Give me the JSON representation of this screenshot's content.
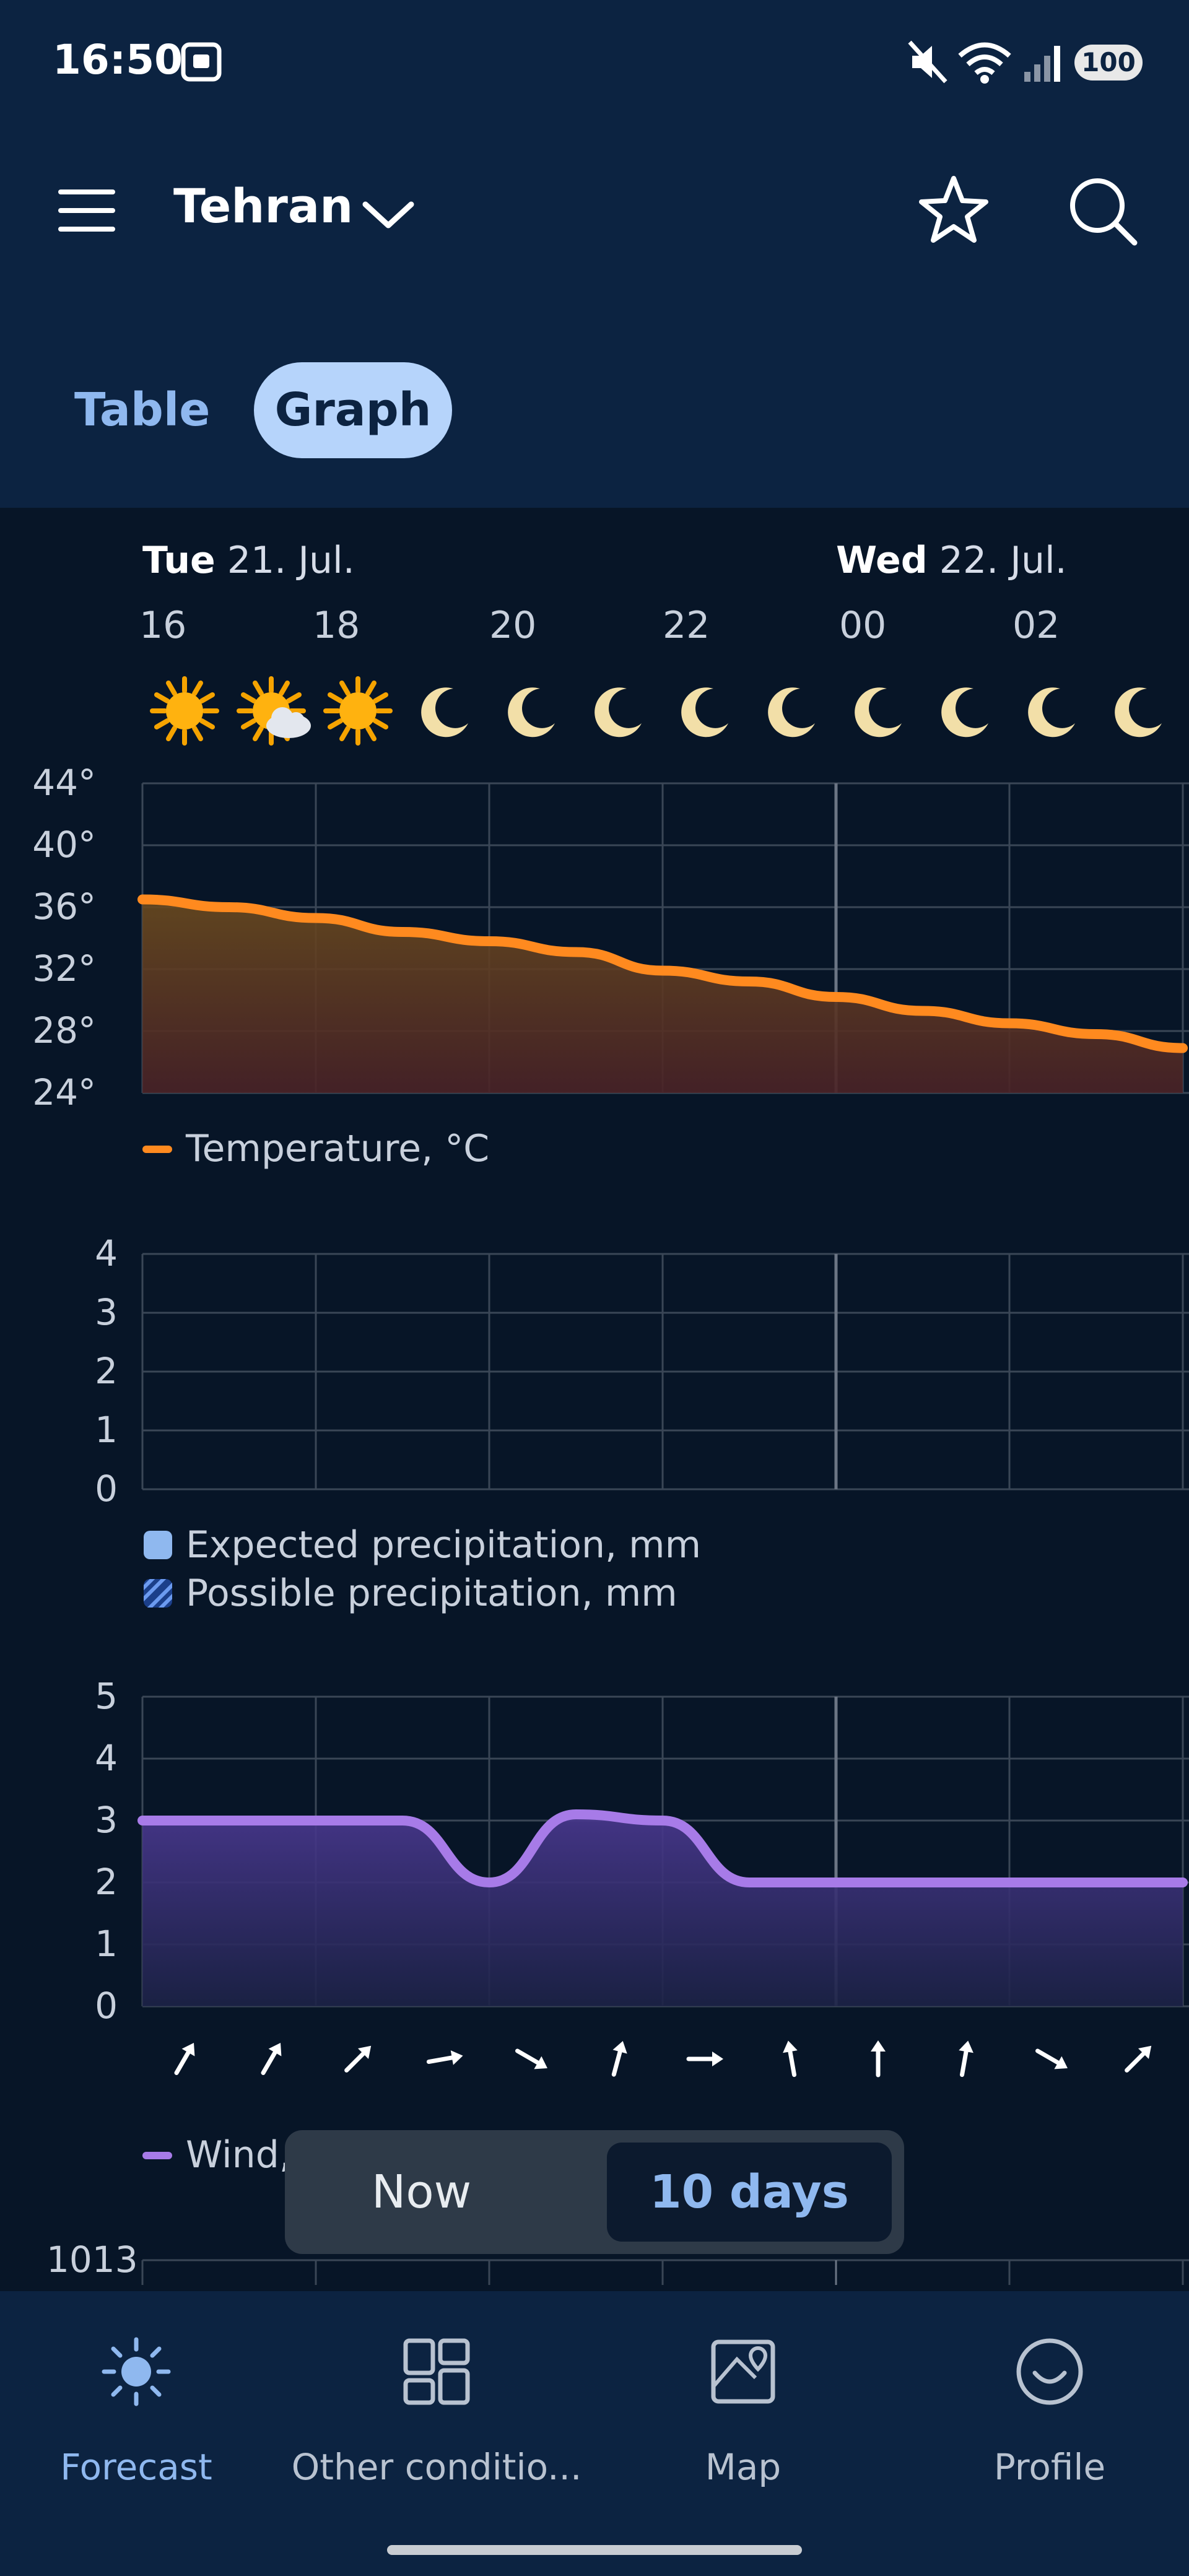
{
  "status_bar": {
    "time": "16:50",
    "battery": "100"
  },
  "header": {
    "city": "Tehran"
  },
  "tabs": [
    {
      "label": "Table",
      "active": false
    },
    {
      "label": "Graph",
      "active": true
    }
  ],
  "days": [
    {
      "weekday": "Tue",
      "date": "21. Jul."
    },
    {
      "weekday": "Wed",
      "date": "22. Jul."
    }
  ],
  "hours": [
    "16",
    "18",
    "20",
    "22",
    "00",
    "02"
  ],
  "weather_icons": [
    "sun-icon",
    "sun-cloud-icon",
    "sun-icon",
    "moon-icon",
    "moon-icon",
    "moon-icon",
    "moon-icon",
    "moon-icon",
    "moon-icon",
    "moon-icon",
    "moon-icon",
    "moon-icon"
  ],
  "wind_directions_deg": [
    30,
    30,
    45,
    80,
    120,
    15,
    90,
    350,
    0,
    10,
    120,
    45
  ],
  "chart_data": [
    {
      "type": "area",
      "x": [
        "16",
        "17",
        "18",
        "19",
        "20",
        "21",
        "22",
        "23",
        "00",
        "01",
        "02",
        "03",
        "04"
      ],
      "series": [
        {
          "name": "Temperature, °C",
          "values": [
            36.5,
            36,
            35.3,
            34.4,
            33.8,
            33.1,
            31.9,
            31.2,
            30.2,
            29.3,
            28.5,
            27.8,
            26.9
          ]
        }
      ],
      "y_ticks": [
        "44°",
        "40°",
        "36°",
        "32°",
        "28°",
        "24°"
      ],
      "ylim": [
        24,
        44
      ],
      "grid": true,
      "color": "#ff8a1f"
    },
    {
      "type": "bar",
      "x": [
        "16",
        "17",
        "18",
        "19",
        "20",
        "21",
        "22",
        "23",
        "00",
        "01",
        "02",
        "03",
        "04"
      ],
      "series": [
        {
          "name": "Expected precipitation, mm",
          "values": [
            0,
            0,
            0,
            0,
            0,
            0,
            0,
            0,
            0,
            0,
            0,
            0,
            0
          ]
        },
        {
          "name": "Possible precipitation, mm",
          "values": [
            0,
            0,
            0,
            0,
            0,
            0,
            0,
            0,
            0,
            0,
            0,
            0,
            0
          ]
        }
      ],
      "y_ticks": [
        "4",
        "3",
        "2",
        "1",
        "0"
      ],
      "ylim": [
        0,
        4
      ],
      "grid": true,
      "colors": [
        "#8fb8ef",
        "#3a6fd8"
      ]
    },
    {
      "type": "area",
      "x": [
        "16",
        "17",
        "18",
        "19",
        "20",
        "21",
        "22",
        "23",
        "00",
        "01",
        "02",
        "03",
        "04"
      ],
      "series": [
        {
          "name": "Wind",
          "values": [
            3,
            3,
            3,
            3,
            2,
            3.1,
            3,
            2,
            2,
            2,
            2,
            2,
            2
          ]
        }
      ],
      "y_ticks": [
        "5",
        "4",
        "3",
        "2",
        "1",
        "0"
      ],
      "ylim": [
        0,
        5
      ],
      "grid": true,
      "color": "#a77be8"
    },
    {
      "type": "line",
      "y_ticks": [
        "1013"
      ]
    }
  ],
  "legends": {
    "temperature": "Temperature, °C",
    "precip_expected": "Expected precipitation, mm",
    "precip_possible": "Possible precipitation, mm",
    "wind": "Wind,"
  },
  "toggle": {
    "now": "Now",
    "ten_days": "10 days"
  },
  "bottom_nav": [
    {
      "label": "Forecast",
      "icon": "sun-icon",
      "active": true
    },
    {
      "label": "Other conditio...",
      "icon": "grid-icon",
      "active": false
    },
    {
      "label": "Map",
      "icon": "map-icon",
      "active": false
    },
    {
      "label": "Profile",
      "icon": "smile-icon",
      "active": false
    }
  ],
  "colors": {
    "header_bg": "#0c2341",
    "content_bg": "#071527",
    "accent": "#8fb8ef",
    "temperature": "#ff8a1f",
    "wind": "#a77be8"
  }
}
